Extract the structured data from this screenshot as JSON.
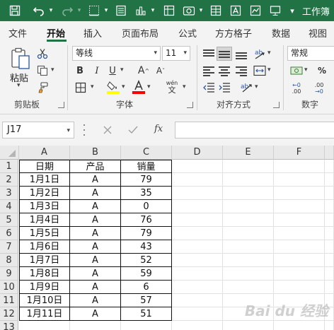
{
  "window": {
    "title": "工作簿"
  },
  "tabs": [
    "文件",
    "开始",
    "插入",
    "页面布局",
    "公式",
    "方方格子",
    "数据",
    "视图"
  ],
  "active_tab": "开始",
  "ribbon": {
    "clipboard": {
      "paste_label": "粘贴",
      "group_label": "剪贴板"
    },
    "font": {
      "name": "等线",
      "size": "11",
      "bold": "B",
      "italic": "I",
      "underline": "U",
      "grow": "A",
      "shrink": "A",
      "phonetic": "wén",
      "group_label": "字体"
    },
    "alignment": {
      "group_label": "对齐方式"
    },
    "number": {
      "format": "常规",
      "group_label": "数字"
    }
  },
  "formula_bar": {
    "name_box": "J17",
    "fx_label": "fx",
    "formula": ""
  },
  "sheet": {
    "columns": [
      "A",
      "B",
      "C",
      "D",
      "E",
      "F"
    ],
    "rows": [
      "1",
      "2",
      "3",
      "4",
      "5",
      "6",
      "7",
      "8",
      "9",
      "10",
      "11",
      "12",
      "13"
    ],
    "data": [
      [
        "日期",
        "产品",
        "销量"
      ],
      [
        "1月1日",
        "A",
        "79"
      ],
      [
        "1月2日",
        "A",
        "35"
      ],
      [
        "1月3日",
        "A",
        "0"
      ],
      [
        "1月4日",
        "A",
        "76"
      ],
      [
        "1月5日",
        "A",
        "79"
      ],
      [
        "1月6日",
        "A",
        "43"
      ],
      [
        "1月7日",
        "A",
        "52"
      ],
      [
        "1月8日",
        "A",
        "59"
      ],
      [
        "1月9日",
        "A",
        "6"
      ],
      [
        "1月10日",
        "A",
        "57"
      ],
      [
        "1月11日",
        "A",
        "51"
      ]
    ]
  },
  "colors": {
    "accent": "#217346",
    "font_highlight": "#ffff00",
    "font_color": "#ff0000"
  },
  "watermark": "Bai du 经验"
}
